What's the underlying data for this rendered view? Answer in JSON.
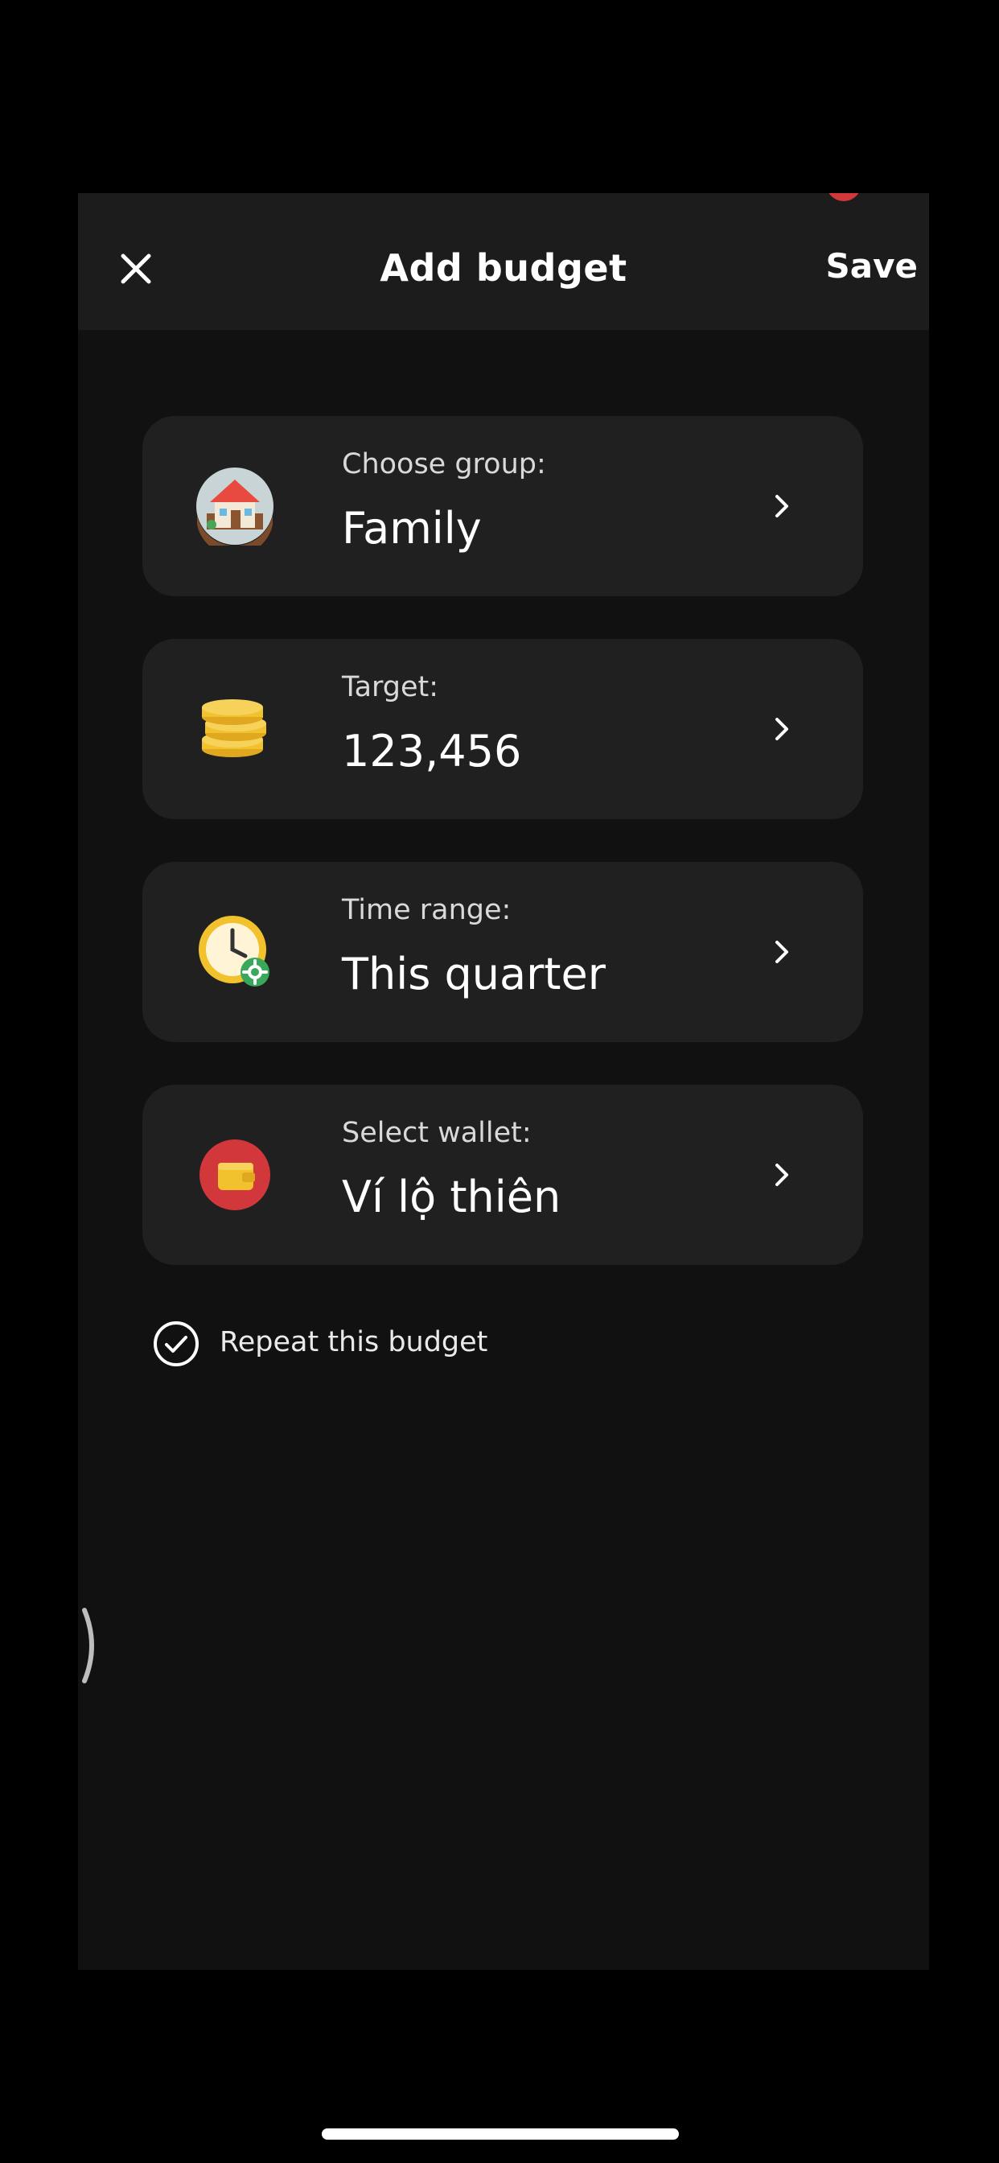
{
  "header": {
    "title": "Add budget",
    "save_label": "Save"
  },
  "cards": [
    {
      "label": "Choose group:",
      "value": "Family",
      "icon": "house-icon"
    },
    {
      "label": "Target:",
      "value": "123,456",
      "icon": "coins-icon"
    },
    {
      "label": "Time range:",
      "value": "This quarter",
      "icon": "clock-settings-icon"
    },
    {
      "label": "Select wallet:",
      "value": "Ví lộ thiên",
      "icon": "wallet-icon"
    }
  ],
  "repeat": {
    "label": "Repeat this budget",
    "checked": true
  },
  "colors": {
    "background": "#101110",
    "header_bg": "#1b1c1b",
    "card_bg": "#1f201f",
    "text": "#ffffff",
    "secondary_text": "#d9d9d9",
    "wallet_red": "#d2383b",
    "coin_gold": "#f2c12e"
  }
}
